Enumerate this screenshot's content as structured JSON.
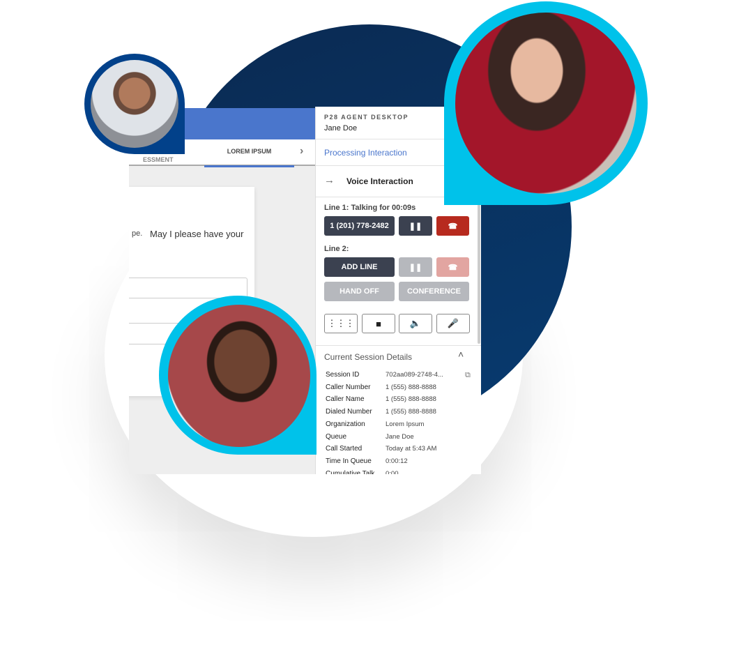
{
  "left_app": {
    "tabs": [
      "ESSMENT",
      "LOREM IPSUM"
    ],
    "card_text_partial": "pe.",
    "card_text": "May I please have your"
  },
  "panel": {
    "app_title": "P28 AGENT DESKTOP",
    "agent_name": "Jane Doe",
    "status": "Processing Interaction",
    "interaction_type": "Voice Interaction",
    "line1_label": "Line 1: Talking for 00:09s",
    "line1_number": "1 (201) 778-2482",
    "line2_label": "Line 2:",
    "add_line": "ADD LINE",
    "hand_off": "HAND OFF",
    "conference": "CONFERENCE",
    "session_title": "Current Session Details",
    "session": [
      {
        "key": "Session ID",
        "value": "702aa089-2748-4..."
      },
      {
        "key": "Caller Number",
        "value": "1 (555) 888-8888"
      },
      {
        "key": "Caller Name",
        "value": "1 (555) 888-8888"
      },
      {
        "key": "Dialed Number",
        "value": "1 (555) 888-8888"
      },
      {
        "key": "Organization",
        "value": "Lorem Ipsum"
      },
      {
        "key": "Queue",
        "value": "Jane Doe"
      },
      {
        "key": "Call Started",
        "value": "Today at 5:43 AM"
      },
      {
        "key": "Time In Queue",
        "value": "0:00:12"
      },
      {
        "key": "Cumulative Talk",
        "value": "0:00"
      }
    ]
  },
  "colors": {
    "navy": "#0a2f5c",
    "cyan": "#00c2ea",
    "accent_blue": "#4a76cc",
    "hangup_red": "#b72a1e",
    "button_dark": "#3b4150"
  },
  "icons": [
    "arrow-right-icon",
    "pause-icon",
    "hang-up-icon",
    "dialpad-icon",
    "stop-icon",
    "speaker-icon",
    "microphone-icon",
    "chevron-up-icon",
    "copy-icon",
    "chevron-right-icon"
  ]
}
